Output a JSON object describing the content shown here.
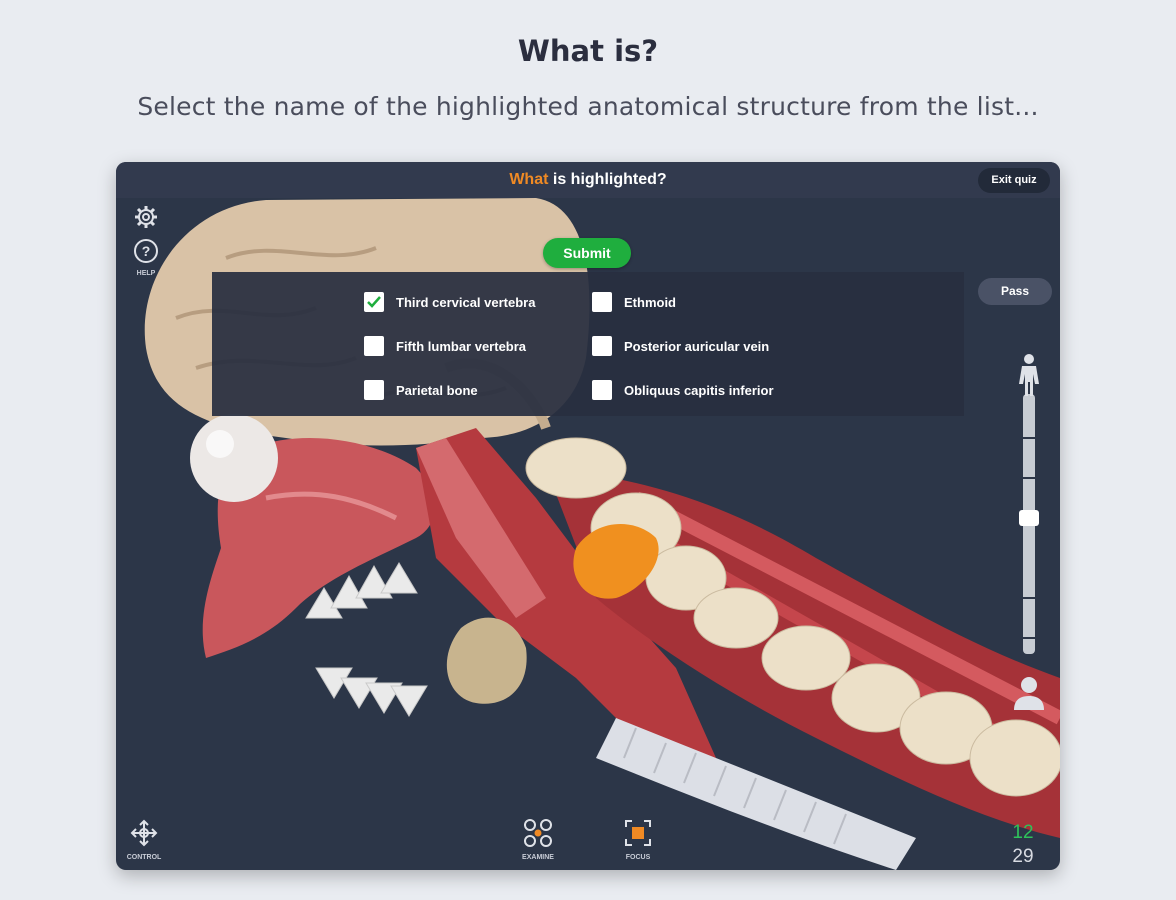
{
  "page": {
    "title": "What is?",
    "subtitle": "Select the name of the highlighted anatomical structure from the list..."
  },
  "topbar": {
    "title_accent": "What",
    "title_rest": " is highlighted?",
    "exit_label": "Exit quiz"
  },
  "quiz": {
    "submit_label": "Submit",
    "pass_label": "Pass",
    "options": [
      {
        "label": "Third cervical vertebra",
        "checked": true
      },
      {
        "label": "Fifth lumbar vertebra",
        "checked": false
      },
      {
        "label": "Parietal bone",
        "checked": false
      },
      {
        "label": "Ethmoid",
        "checked": false
      },
      {
        "label": "Posterior auricular vein",
        "checked": false
      },
      {
        "label": "Obliquus capitis inferior",
        "checked": false
      }
    ]
  },
  "tools": {
    "settings_icon": "gear-icon",
    "help_label": "HELP",
    "control_label": "CONTROL",
    "examine_label": "EXAMINE",
    "focus_label": "FOCUS"
  },
  "counter": {
    "current": "12",
    "total": "29"
  },
  "colors": {
    "accent": "#f08a24",
    "submit": "#1fae3e",
    "background": "#2c3648",
    "highlight": "#f0901f"
  }
}
